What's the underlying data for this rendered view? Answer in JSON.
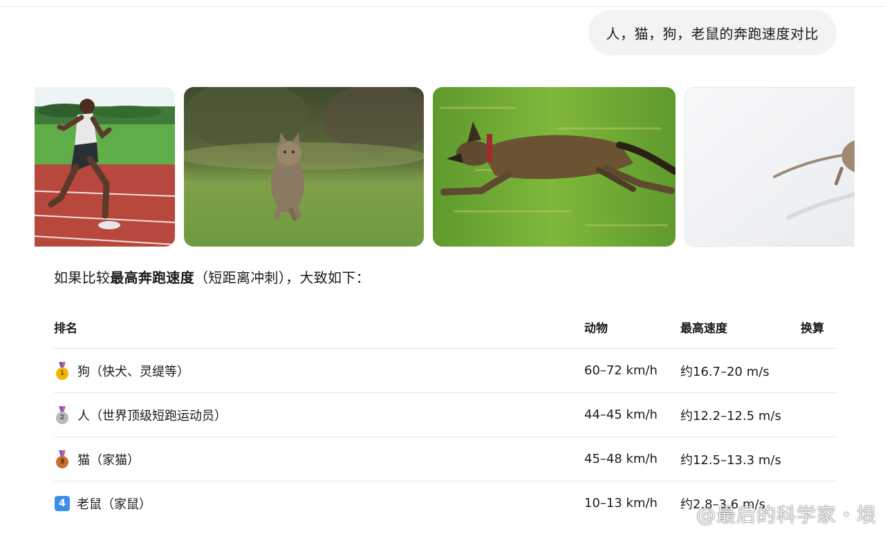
{
  "user_message": "人，猫，狗，老鼠的奔跑速度对比",
  "images": [
    {
      "name": "human-sprinter-image"
    },
    {
      "name": "running-cat-image"
    },
    {
      "name": "running-dog-image"
    },
    {
      "name": "running-mouse-image"
    }
  ],
  "intro": {
    "prefix": "如果比较",
    "bold": "最高奔跑速度",
    "suffix": "（短距离冲刺），大致如下："
  },
  "table": {
    "headers": {
      "rank": "排名",
      "animal": "动物",
      "top_speed": "最高速度",
      "conversion": "换算"
    },
    "rows": [
      {
        "badge": "gold-medal-icon",
        "badge_text": "1",
        "rank": "狗（快犬、灵缇等）",
        "animal": "60–72 km/h",
        "top_speed": "约16.7–20 m/s"
      },
      {
        "badge": "silver-medal-icon",
        "badge_text": "2",
        "rank": "人（世界顶级短跑运动员）",
        "animal": "44–45 km/h",
        "top_speed": "约12.2–12.5 m/s"
      },
      {
        "badge": "bronze-medal-icon",
        "badge_text": "3",
        "rank": "猫（家猫）",
        "animal": "45–48 km/h",
        "top_speed": "约12.5–13.3 m/s"
      },
      {
        "badge": "keycap-four-icon",
        "badge_text": "4",
        "rank": "老鼠（家鼠）",
        "animal": "10–13 km/h",
        "top_speed": "约2.8–3.6 m/s"
      }
    ]
  },
  "watermark": {
    "text": "@最后的科学家・垠",
    "icon": "weibo-logo-icon"
  }
}
